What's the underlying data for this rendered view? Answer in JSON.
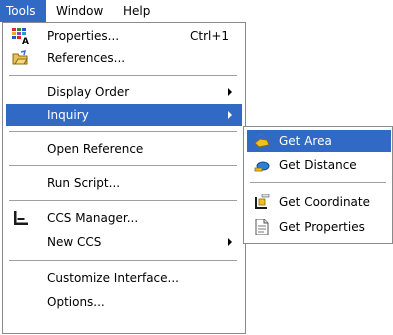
{
  "menubar": {
    "items": [
      {
        "label": "Tools",
        "active": true
      },
      {
        "label": "Window",
        "active": false
      },
      {
        "label": "Help",
        "active": false
      }
    ]
  },
  "tools_menu": {
    "properties": {
      "label": "Properties...",
      "shortcut": "Ctrl+1",
      "icon": "properties-icon"
    },
    "references": {
      "label": "References...",
      "icon": "references-icon"
    },
    "display_order": {
      "label": "Display Order"
    },
    "inquiry": {
      "label": "Inquiry"
    },
    "open_reference": {
      "label": "Open Reference"
    },
    "run_script": {
      "label": "Run Script..."
    },
    "ccs_manager": {
      "label": "CCS Manager...",
      "icon": "ccs-manager-icon"
    },
    "new_ccs": {
      "label": "New CCS"
    },
    "customize_interface": {
      "label": "Customize Interface..."
    },
    "options": {
      "label": "Options..."
    }
  },
  "inquiry_submenu": {
    "get_area": {
      "label": "Get Area",
      "icon": "get-area-icon"
    },
    "get_distance": {
      "label": "Get Distance",
      "icon": "get-distance-icon"
    },
    "get_coordinate": {
      "label": "Get Coordinate",
      "icon": "get-coordinate-icon"
    },
    "get_properties": {
      "label": "Get Properties",
      "icon": "get-properties-icon"
    }
  },
  "colors": {
    "highlight": "#316ac5",
    "highlight_text": "#ffffff",
    "menu_background": "#ffffff",
    "border": "#8a8a8a"
  }
}
